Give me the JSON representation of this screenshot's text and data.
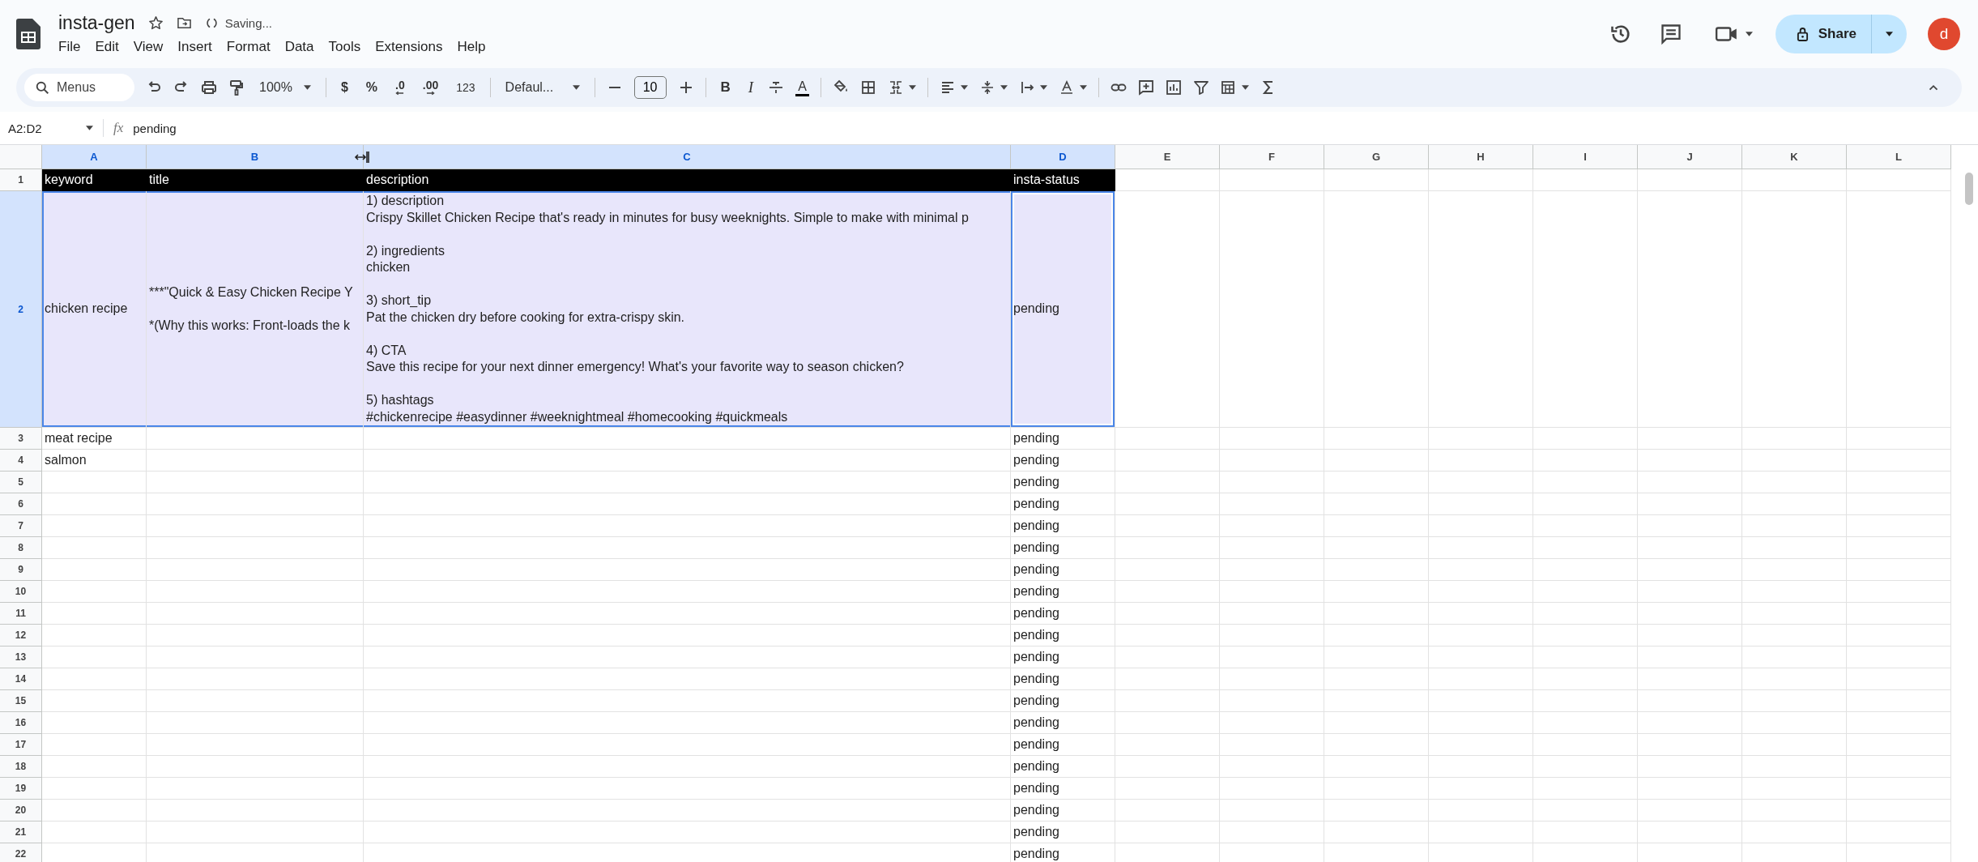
{
  "document": {
    "title": "insta-gen",
    "save_status": "Saving..."
  },
  "menu": [
    "File",
    "Edit",
    "View",
    "Insert",
    "Format",
    "Data",
    "Tools",
    "Extensions",
    "Help"
  ],
  "share": {
    "label": "Share"
  },
  "avatar": {
    "initial": "d"
  },
  "toolbar": {
    "search_placeholder": "Menus",
    "zoom": "100%",
    "currency": "$",
    "percent": "%",
    "decrease_decimal": ".0",
    "increase_decimal": ".00",
    "number_format": "123",
    "font": "Defaul...",
    "font_size": "10",
    "bold": "B",
    "italic": "I",
    "text_color": "A"
  },
  "formula_bar": {
    "range": "A2:D2",
    "function_symbol": "fx",
    "value": "pending"
  },
  "sheet": {
    "columns": [
      {
        "label": "A",
        "selected": true
      },
      {
        "label": "B",
        "selected": true
      },
      {
        "label": "C",
        "selected": true
      },
      {
        "label": "D",
        "selected": true,
        "active": true
      },
      {
        "label": "E",
        "selected": false
      },
      {
        "label": "F",
        "selected": false
      },
      {
        "label": "G",
        "selected": false
      },
      {
        "label": "H",
        "selected": false
      },
      {
        "label": "I",
        "selected": false
      },
      {
        "label": "J",
        "selected": false
      },
      {
        "label": "K",
        "selected": false
      },
      {
        "label": "L",
        "selected": false
      }
    ],
    "rows": [
      {
        "number": "1",
        "kind": "header",
        "selected": false,
        "cells": {
          "A": "keyword",
          "B": "title",
          "C": "description",
          "D": "insta-status"
        }
      },
      {
        "number": "2",
        "kind": "data",
        "selected": true,
        "cells": {
          "A": "chicken recipe",
          "B": "***\"Quick & Easy Chicken Recipe Y\n\n*(Why this works: Front-loads the k",
          "C": "1) description\nCrispy Skillet Chicken Recipe that's ready in minutes for busy weeknights. Simple to make with minimal p\n\n2) ingredients\nchicken\n\n3) short_tip\nPat the chicken dry before cooking for extra-crispy skin.\n\n4) CTA\nSave this recipe for your next dinner emergency! What's your favorite way to season chicken?\n\n5) hashtags\n#chickenrecipe #easydinner #weeknightmeal #homecooking #quickmeals",
          "D": "pending"
        }
      },
      {
        "number": "3",
        "kind": "data",
        "selected": false,
        "cells": {
          "A": "meat recipe",
          "D": "pending"
        }
      },
      {
        "number": "4",
        "kind": "data",
        "selected": false,
        "cells": {
          "A": "salmon",
          "D": "pending"
        }
      },
      {
        "number": "5",
        "kind": "data",
        "selected": false,
        "cells": {
          "D": "pending"
        }
      },
      {
        "number": "6",
        "kind": "data",
        "selected": false,
        "cells": {
          "D": "pending"
        }
      },
      {
        "number": "7",
        "kind": "data",
        "selected": false,
        "cells": {
          "D": "pending"
        }
      },
      {
        "number": "8",
        "kind": "data",
        "selected": false,
        "cells": {
          "D": "pending"
        }
      },
      {
        "number": "9",
        "kind": "data",
        "selected": false,
        "cells": {
          "D": "pending"
        }
      },
      {
        "number": "10",
        "kind": "data",
        "selected": false,
        "cells": {
          "D": "pending"
        }
      },
      {
        "number": "11",
        "kind": "data",
        "selected": false,
        "cells": {
          "D": "pending"
        }
      },
      {
        "number": "12",
        "kind": "data",
        "selected": false,
        "cells": {
          "D": "pending"
        }
      },
      {
        "number": "13",
        "kind": "data",
        "selected": false,
        "cells": {
          "D": "pending"
        }
      },
      {
        "number": "14",
        "kind": "data",
        "selected": false,
        "cells": {
          "D": "pending"
        }
      },
      {
        "number": "15",
        "kind": "data",
        "selected": false,
        "cells": {
          "D": "pending"
        }
      },
      {
        "number": "16",
        "kind": "data",
        "selected": false,
        "cells": {
          "D": "pending"
        }
      },
      {
        "number": "17",
        "kind": "data",
        "selected": false,
        "cells": {
          "D": "pending"
        }
      },
      {
        "number": "18",
        "kind": "data",
        "selected": false,
        "cells": {
          "D": "pending"
        }
      },
      {
        "number": "19",
        "kind": "data",
        "selected": false,
        "cells": {
          "D": "pending"
        }
      },
      {
        "number": "20",
        "kind": "data",
        "selected": false,
        "cells": {
          "D": "pending"
        }
      },
      {
        "number": "21",
        "kind": "data",
        "selected": false,
        "cells": {
          "D": "pending"
        }
      },
      {
        "number": "22",
        "kind": "data",
        "selected": false,
        "cells": {
          "D": "pending"
        }
      }
    ]
  }
}
